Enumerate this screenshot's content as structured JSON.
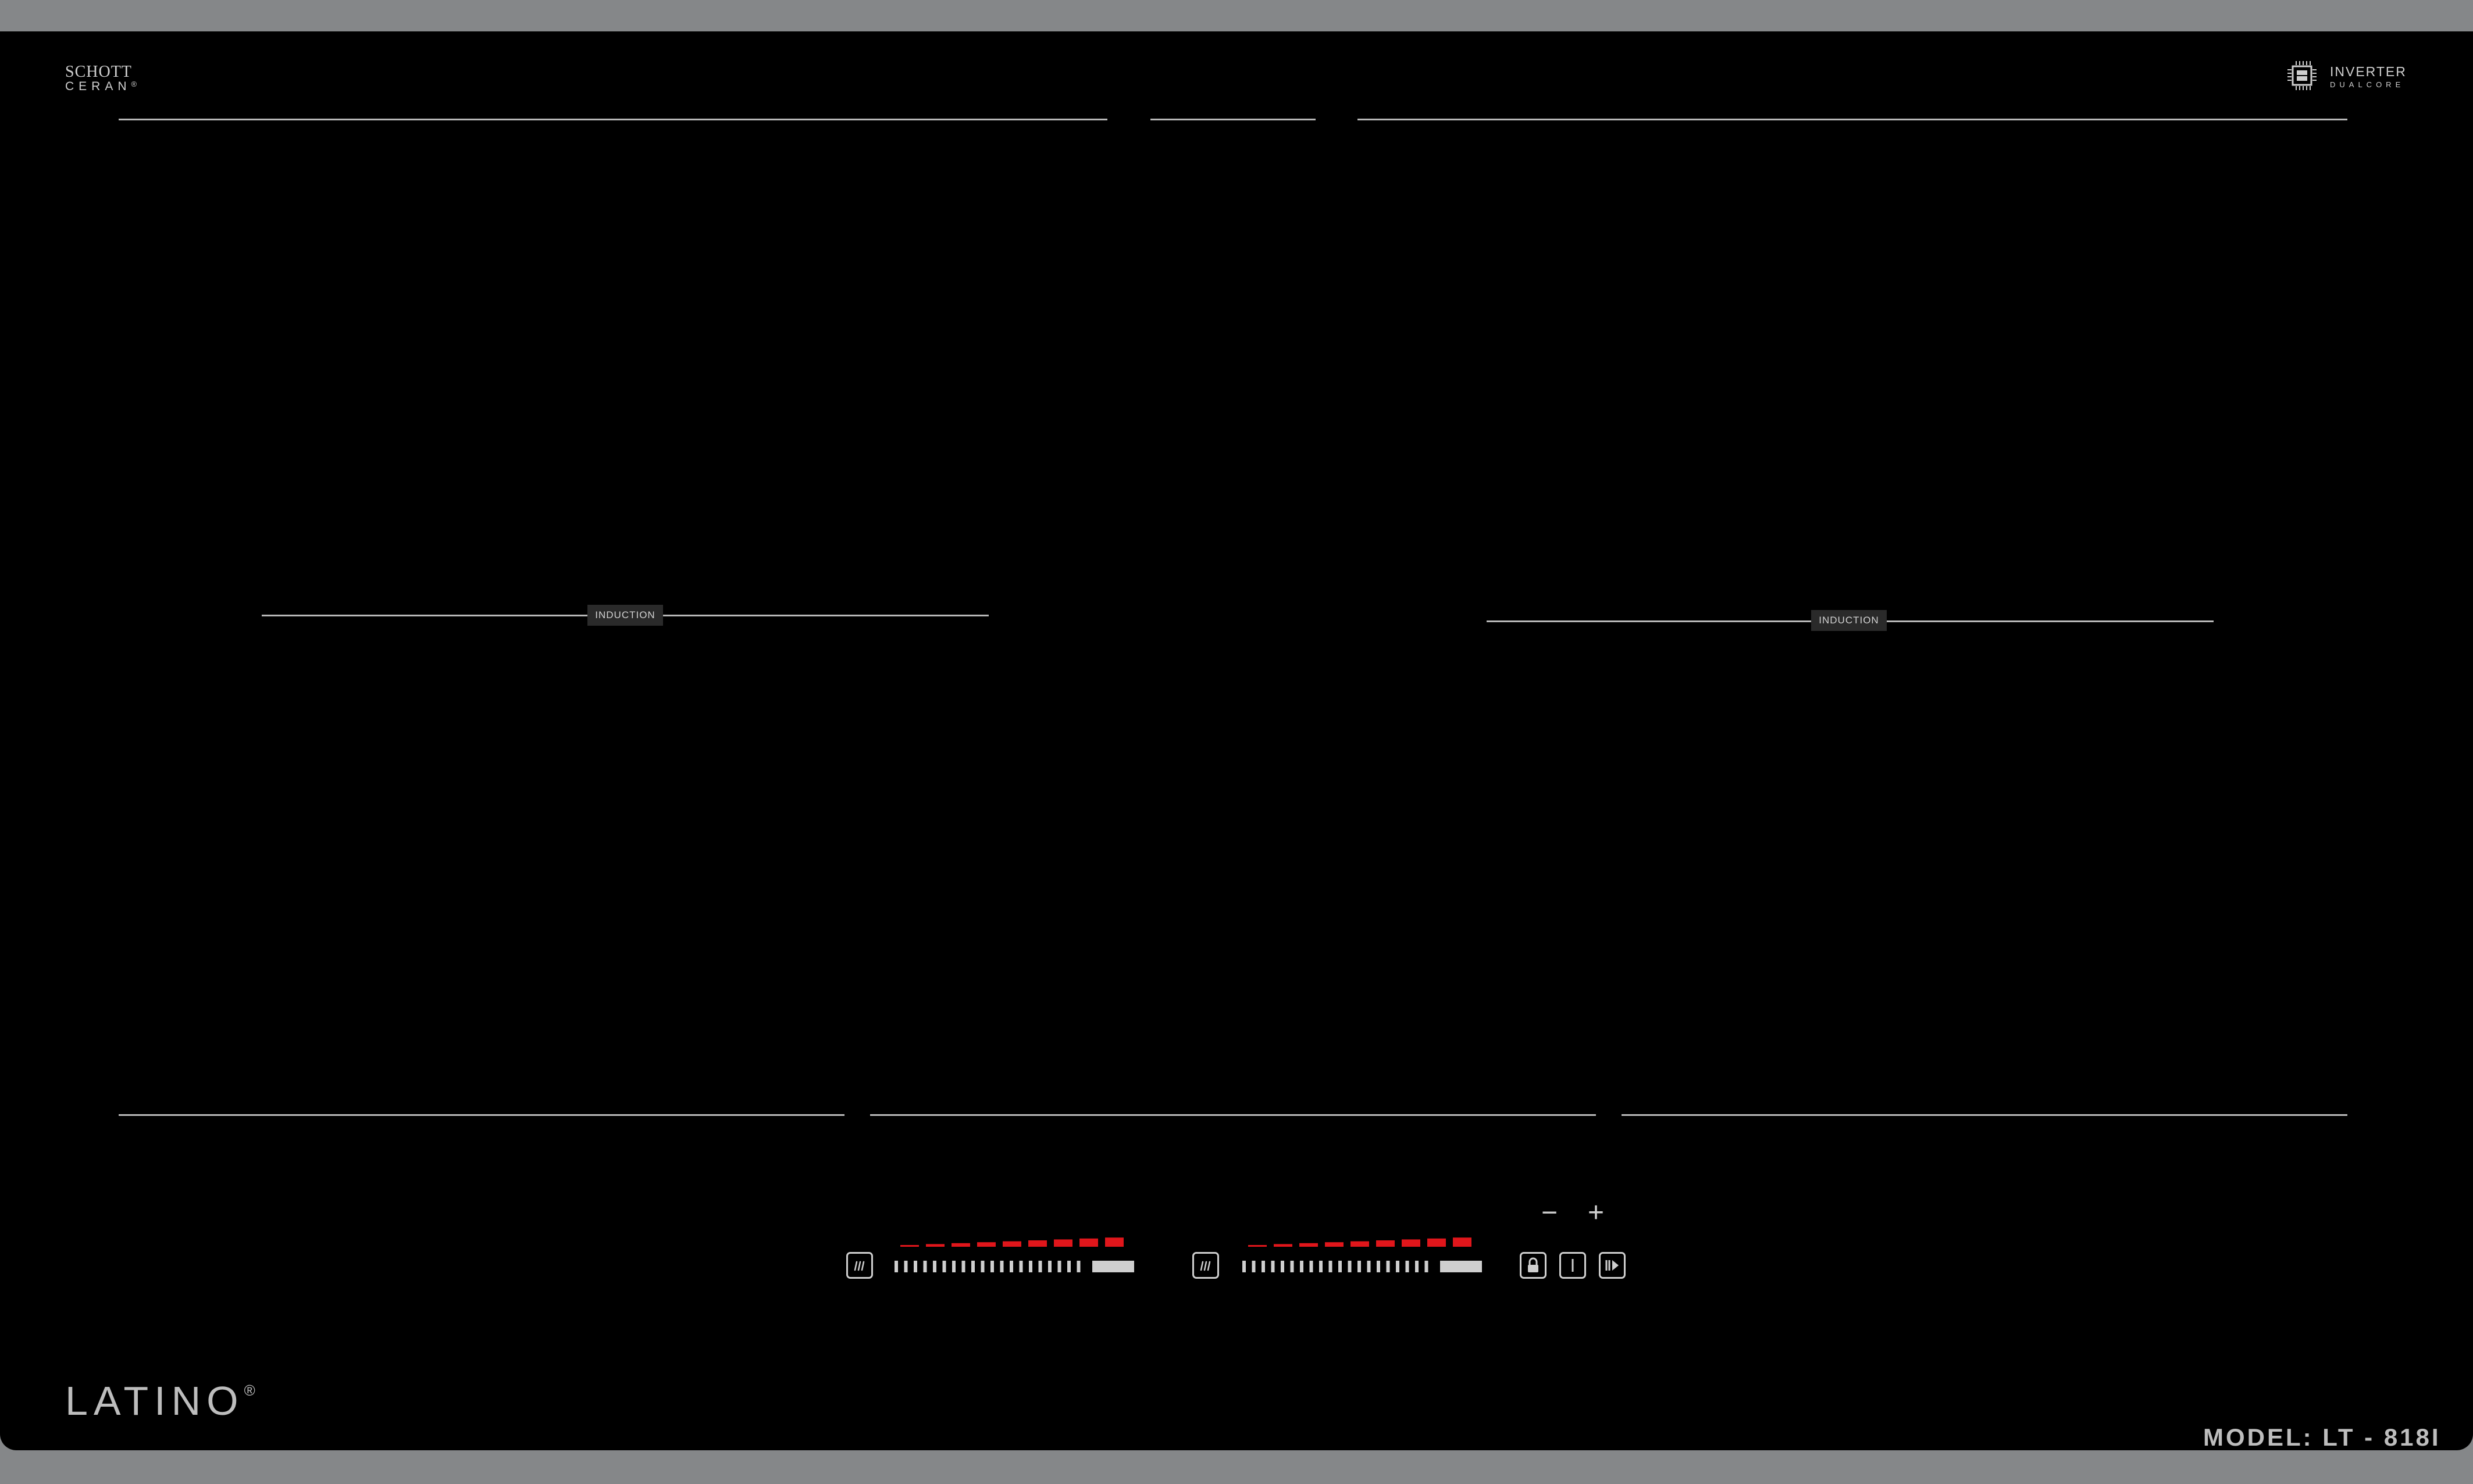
{
  "brand": {
    "schott_line1": "SCHOTT",
    "schott_line2": "CERAN",
    "schott_reg": "®",
    "inverter_line1": "INVERTER",
    "inverter_line2": "DUALCORE",
    "logo": "LATINO",
    "logo_reg": "®"
  },
  "zones": [
    {
      "label": "INDUCTION"
    },
    {
      "label": "INDUCTION"
    }
  ],
  "controls": {
    "minus_label": "−",
    "plus_label": "+",
    "zone_left": {
      "icon": "heat-zone-icon",
      "level_steps": 9
    },
    "zone_right": {
      "icon": "heat-zone-icon",
      "level_steps": 9
    },
    "lock_icon": "lock-icon",
    "power_icon": "power-icon",
    "boost_icon": "boost-icon"
  },
  "colors": {
    "glass": "#000000",
    "frame": "#858789",
    "print": "#bdbdbd",
    "level_red": "#e0161b"
  },
  "model_label": "MODEL: LT - 818I"
}
